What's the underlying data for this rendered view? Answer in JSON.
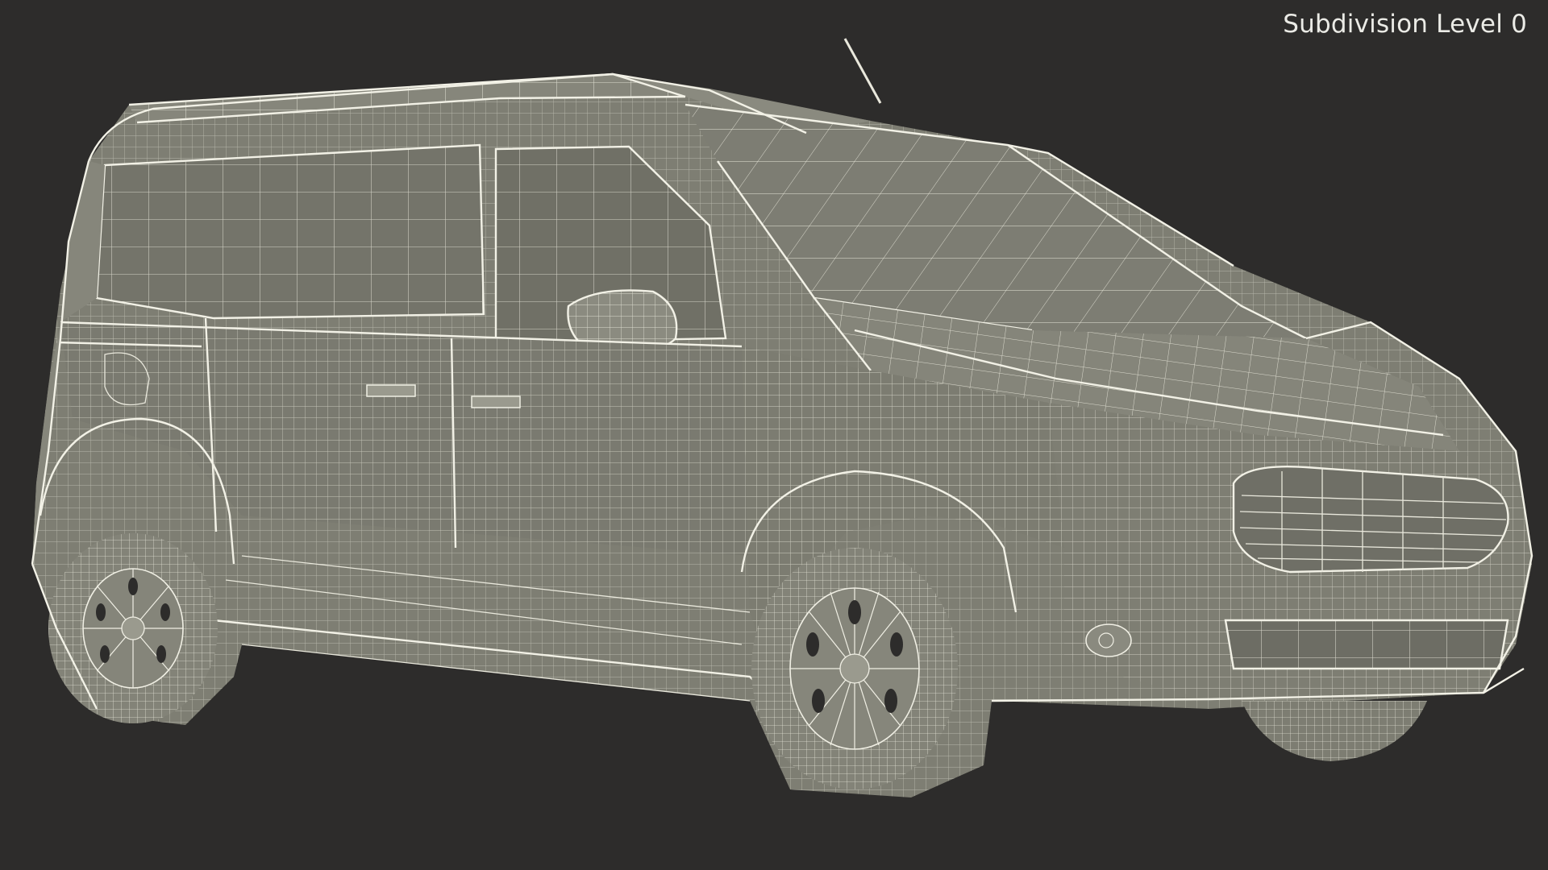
{
  "viewport": {
    "overlay_label": "Subdivision Level 0",
    "background_color": "#2d2c2b",
    "wire_color": "#e9e8dc",
    "surface_color": "#7c7c72"
  },
  "model": {
    "icon": "van-wireframe-icon"
  }
}
